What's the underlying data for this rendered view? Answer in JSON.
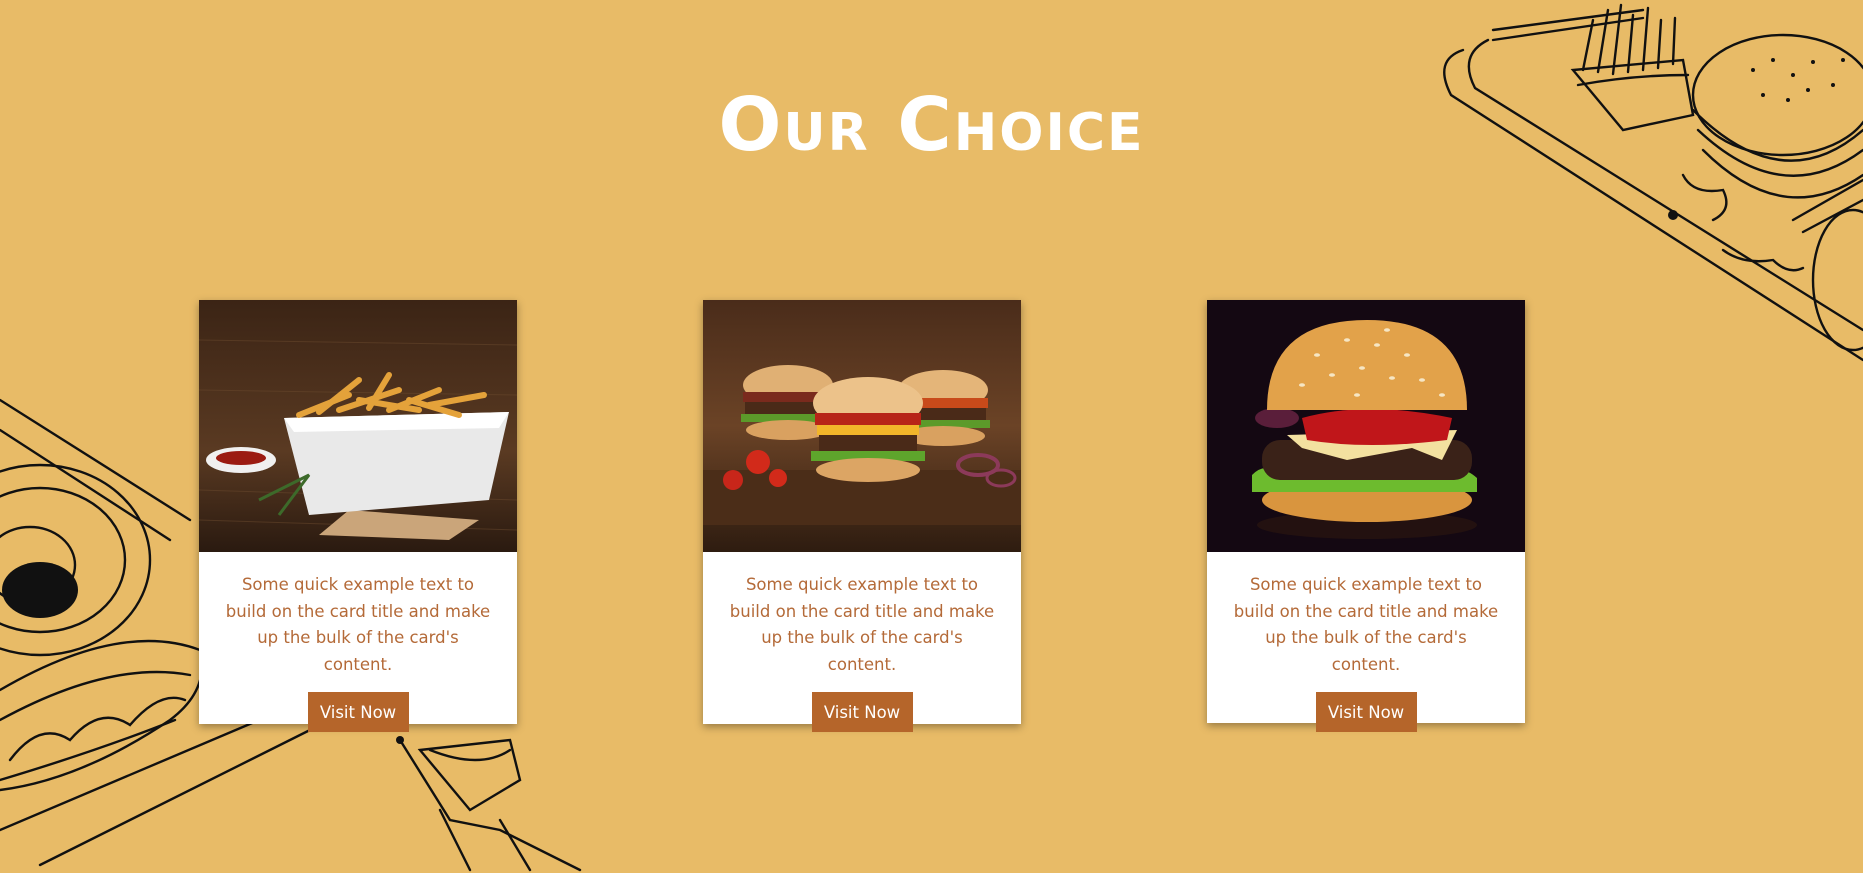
{
  "heading": {
    "title": "Our Choice"
  },
  "colors": {
    "background": "#e8bb67",
    "card_background": "#ffffff",
    "card_text": "#b46a38",
    "button": "#b5652a",
    "heading": "#ffffff"
  },
  "cards": [
    {
      "image": "fries-bowl-image",
      "text": "Some quick example text to build on the card title and make up the bulk of the card's content.",
      "button_label": "Visit Now"
    },
    {
      "image": "three-burgers-image",
      "text": "Some quick example text to build on the card title and make up the bulk of the card's content.",
      "button_label": "Visit Now"
    },
    {
      "image": "single-burger-image",
      "text": "Some quick example text to build on the card title and make up the bulk of the card's content.",
      "button_label": "Visit Now"
    }
  ]
}
